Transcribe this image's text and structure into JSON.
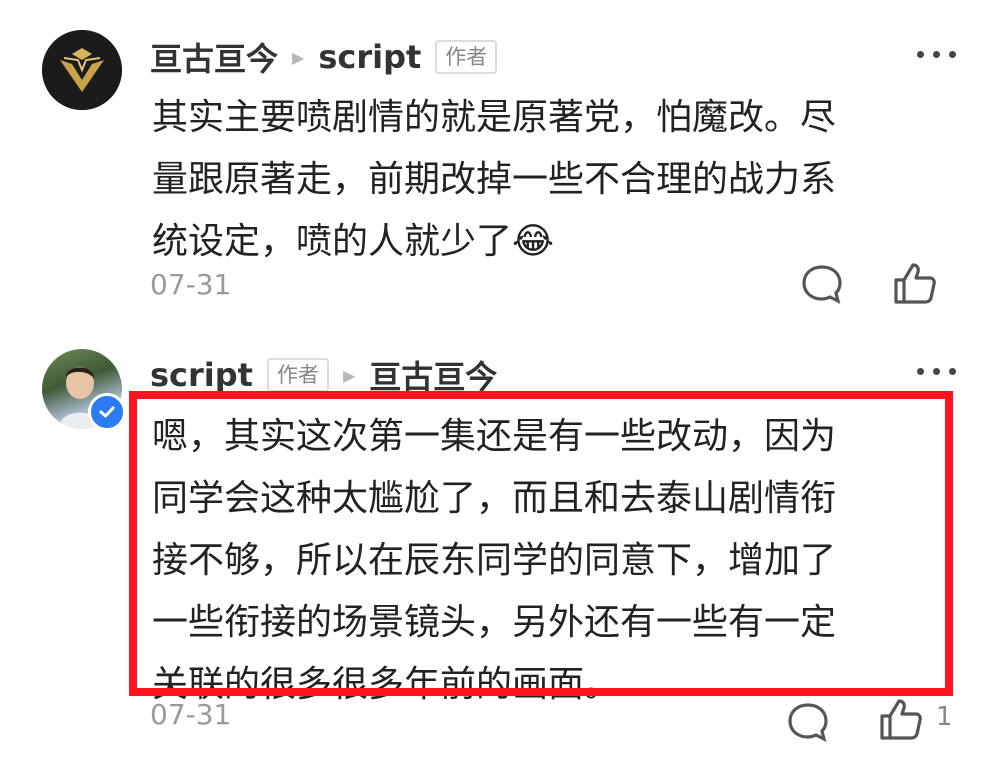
{
  "comments": [
    {
      "author": "亘古亘今",
      "reply_to": "script",
      "reply_to_tag": "作者",
      "text_lines": [
        "其实主要喷剧情的就是原著党，怕魔改。尽",
        "量跟原著走，前期改掉一些不合理的战力系",
        "统设定，喷的人就少了"
      ],
      "emoji": "😂",
      "date": "07-31"
    },
    {
      "author": "script",
      "author_tag": "作者",
      "reply_to": "亘古亘今",
      "text_lines": [
        "嗯，其实这次第一集还是有一些改动，因为",
        "同学会这种太尴尬了，而且和去泰山剧情衔",
        "接不够，所以在辰东同学的同意下，增加了",
        "一些衔接的场景镜头，另外还有一些有一定",
        "关联的很多很多年前的画面。"
      ],
      "date": "07-31",
      "like_count": "1"
    }
  ],
  "colors": {
    "highlight": "#ff1420",
    "verified": "#2b7bf3"
  }
}
